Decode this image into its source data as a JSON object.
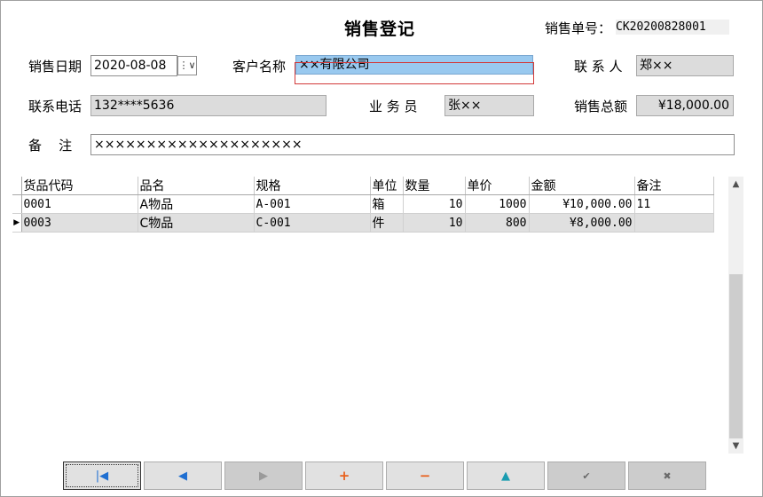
{
  "title": "销售登记",
  "order": {
    "label": "销售单号：",
    "value": "CK20200828001"
  },
  "form": {
    "sale_date": {
      "label": "销售日期",
      "value": "2020-08-08",
      "spin": "⋮∨"
    },
    "customer": {
      "label": "客户名称",
      "value": "××有限公司"
    },
    "contact": {
      "label": "联 系 人",
      "value": "郑××"
    },
    "phone": {
      "label": "联系电话",
      "value": "132****5636"
    },
    "salesman": {
      "label": "业 务 员",
      "value": "张××"
    },
    "total": {
      "label": "销售总额",
      "value": "¥18,000.00"
    },
    "remark": {
      "label": "备    注",
      "value": "××××××××××××××××××××"
    }
  },
  "grid": {
    "columns": [
      "货品代码",
      "品名",
      "规格",
      "单位",
      "数量",
      "单价",
      "金额",
      "备注"
    ],
    "rows": [
      {
        "indicator": "",
        "code": "0001",
        "name": "A物品",
        "spec": "A-001",
        "unit": "箱",
        "qty": "10",
        "price": "1000",
        "amount": "¥10,000.00",
        "note": "11"
      },
      {
        "indicator": "▶",
        "code": "0003",
        "name": "C物品",
        "spec": "C-001",
        "unit": "件",
        "qty": "10",
        "price": "800",
        "amount": "¥8,000.00",
        "note": ""
      }
    ]
  },
  "scrollbar": {
    "up": "▲",
    "down": "▼"
  },
  "nav": {
    "first": "|◀",
    "prev": "◀",
    "next": "▶",
    "add": "+",
    "delete": "−",
    "edit": "▲",
    "save": "✔",
    "cancel": "✖",
    "colors": {
      "blue": "#1f6fd1",
      "orange": "#e8601c",
      "teal": "#1a9cb0",
      "gray": "#6a6a6a"
    }
  }
}
